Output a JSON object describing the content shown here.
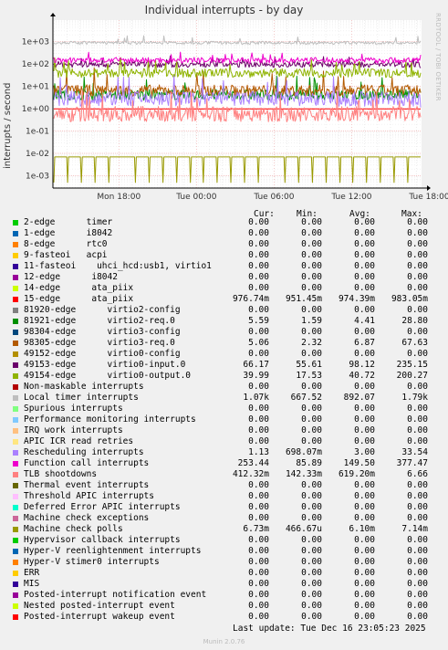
{
  "title": "Individual interrupts - by day",
  "side_label": "RRDTOOL / TOBI OETIKER",
  "footer": {
    "last_update": "Last update: Tue Dec 16 23:05:23 2025",
    "version": "Munin 2.0.76"
  },
  "legend_headers": {
    "cur": "Cur:",
    "min": "Min:",
    "avg": "Avg:",
    "max": "Max:"
  },
  "chart_data": {
    "type": "line",
    "title": "Individual interrupts - by day",
    "ylabel": "interrupts / second",
    "y_scale": "log",
    "ylim": [
      0.0003,
      3000
    ],
    "y_ticks": [
      "1e-03",
      "1e-02",
      "1e-01",
      "1e+00",
      "1e+01",
      "1e+02",
      "1e+03"
    ],
    "x_ticks": [
      "Mon 18:00",
      "Tue 00:00",
      "Tue 06:00",
      "Tue 12:00",
      "Tue 18:00"
    ],
    "grid": true,
    "series": [
      {
        "name": "2-edge      timer",
        "color": "#00cc00",
        "cur": "0.00",
        "min": "0.00",
        "avg": "0.00",
        "max": "0.00"
      },
      {
        "name": "1-edge      i8042",
        "color": "#0066b3",
        "cur": "0.00",
        "min": "0.00",
        "avg": "0.00",
        "max": "0.00"
      },
      {
        "name": "8-edge      rtc0",
        "color": "#ff8000",
        "cur": "0.00",
        "min": "0.00",
        "avg": "0.00",
        "max": "0.00"
      },
      {
        "name": "9-fasteoi   acpi",
        "color": "#ffcc00",
        "cur": "0.00",
        "min": "0.00",
        "avg": "0.00",
        "max": "0.00"
      },
      {
        "name": "11-fasteoi    uhci_hcd:usb1, virtio1",
        "color": "#330099",
        "cur": "0.00",
        "min": "0.00",
        "avg": "0.00",
        "max": "0.00"
      },
      {
        "name": "12-edge      i8042",
        "color": "#990099",
        "cur": "0.00",
        "min": "0.00",
        "avg": "0.00",
        "max": "0.00"
      },
      {
        "name": "14-edge      ata_piix",
        "color": "#ccff00",
        "cur": "0.00",
        "min": "0.00",
        "avg": "0.00",
        "max": "0.00"
      },
      {
        "name": "15-edge      ata_piix",
        "color": "#ff0000",
        "cur": "976.74m",
        "min": "951.45m",
        "avg": "974.39m",
        "max": "983.05m"
      },
      {
        "name": "81920-edge      virtio2-config",
        "color": "#808080",
        "cur": "0.00",
        "min": "0.00",
        "avg": "0.00",
        "max": "0.00"
      },
      {
        "name": "81921-edge      virtio2-req.0",
        "color": "#008f00",
        "cur": "5.59",
        "min": "1.59",
        "avg": "4.41",
        "max": "28.80"
      },
      {
        "name": "98304-edge      virtio3-config",
        "color": "#00487d",
        "cur": "0.00",
        "min": "0.00",
        "avg": "0.00",
        "max": "0.00"
      },
      {
        "name": "98305-edge      virtio3-req.0",
        "color": "#b35a00",
        "cur": "5.06",
        "min": "2.32",
        "avg": "6.87",
        "max": "67.63"
      },
      {
        "name": "49152-edge      virtio0-config",
        "color": "#b38f00",
        "cur": "0.00",
        "min": "0.00",
        "avg": "0.00",
        "max": "0.00"
      },
      {
        "name": "49153-edge      virtio0-input.0",
        "color": "#6b006b",
        "cur": "66.17",
        "min": "55.61",
        "avg": "98.12",
        "max": "235.15"
      },
      {
        "name": "49154-edge      virtio0-output.0",
        "color": "#8fb300",
        "cur": "39.99",
        "min": "17.53",
        "avg": "40.72",
        "max": "200.27"
      },
      {
        "name": "Non-maskable interrupts",
        "color": "#b30000",
        "cur": "0.00",
        "min": "0.00",
        "avg": "0.00",
        "max": "0.00"
      },
      {
        "name": "Local timer interrupts",
        "color": "#bebebe",
        "cur": "1.07k",
        "min": "667.52",
        "avg": "892.07",
        "max": "1.79k"
      },
      {
        "name": "Spurious interrupts",
        "color": "#80ff80",
        "cur": "0.00",
        "min": "0.00",
        "avg": "0.00",
        "max": "0.00"
      },
      {
        "name": "Performance monitoring interrupts",
        "color": "#80c9ff",
        "cur": "0.00",
        "min": "0.00",
        "avg": "0.00",
        "max": "0.00"
      },
      {
        "name": "IRQ work interrupts",
        "color": "#ffc080",
        "cur": "0.00",
        "min": "0.00",
        "avg": "0.00",
        "max": "0.00"
      },
      {
        "name": "APIC ICR read retries",
        "color": "#ffe680",
        "cur": "0.00",
        "min": "0.00",
        "avg": "0.00",
        "max": "0.00"
      },
      {
        "name": "Rescheduling interrupts",
        "color": "#aa80ff",
        "cur": "1.13",
        "min": "698.07m",
        "avg": "3.00",
        "max": "33.54"
      },
      {
        "name": "Function call interrupts",
        "color": "#ee00cc",
        "cur": "253.44",
        "min": "85.89",
        "avg": "149.50",
        "max": "377.47"
      },
      {
        "name": "TLB shootdowns",
        "color": "#ff8080",
        "cur": "412.32m",
        "min": "142.33m",
        "avg": "619.20m",
        "max": "6.66"
      },
      {
        "name": "Thermal event interrupts",
        "color": "#666600",
        "cur": "0.00",
        "min": "0.00",
        "avg": "0.00",
        "max": "0.00"
      },
      {
        "name": "Threshold APIC interrupts",
        "color": "#ffbfff",
        "cur": "0.00",
        "min": "0.00",
        "avg": "0.00",
        "max": "0.00"
      },
      {
        "name": "Deferred Error APIC interrupts",
        "color": "#00ffcc",
        "cur": "0.00",
        "min": "0.00",
        "avg": "0.00",
        "max": "0.00"
      },
      {
        "name": "Machine check exceptions",
        "color": "#cc6699",
        "cur": "0.00",
        "min": "0.00",
        "avg": "0.00",
        "max": "0.00"
      },
      {
        "name": "Machine check polls",
        "color": "#999900",
        "cur": "6.73m",
        "min": "466.67u",
        "avg": "6.10m",
        "max": "7.14m"
      },
      {
        "name": "Hypervisor callback interrupts",
        "color": "#00cc00",
        "cur": "0.00",
        "min": "0.00",
        "avg": "0.00",
        "max": "0.00"
      },
      {
        "name": "Hyper-V reenlightenment interrupts",
        "color": "#0066b3",
        "cur": "0.00",
        "min": "0.00",
        "avg": "0.00",
        "max": "0.00"
      },
      {
        "name": "Hyper-V stimer0 interrupts",
        "color": "#ff8000",
        "cur": "0.00",
        "min": "0.00",
        "avg": "0.00",
        "max": "0.00"
      },
      {
        "name": "ERR",
        "color": "#ffcc00",
        "cur": "0.00",
        "min": "0.00",
        "avg": "0.00",
        "max": "0.00"
      },
      {
        "name": "MIS",
        "color": "#330099",
        "cur": "0.00",
        "min": "0.00",
        "avg": "0.00",
        "max": "0.00"
      },
      {
        "name": "Posted-interrupt notification event",
        "color": "#990099",
        "cur": "0.00",
        "min": "0.00",
        "avg": "0.00",
        "max": "0.00"
      },
      {
        "name": "Nested posted-interrupt event",
        "color": "#ccff00",
        "cur": "0.00",
        "min": "0.00",
        "avg": "0.00",
        "max": "0.00"
      },
      {
        "name": "Posted-interrupt wakeup event",
        "color": "#ff0000",
        "cur": "0.00",
        "min": "0.00",
        "avg": "0.00",
        "max": "0.00"
      }
    ]
  }
}
